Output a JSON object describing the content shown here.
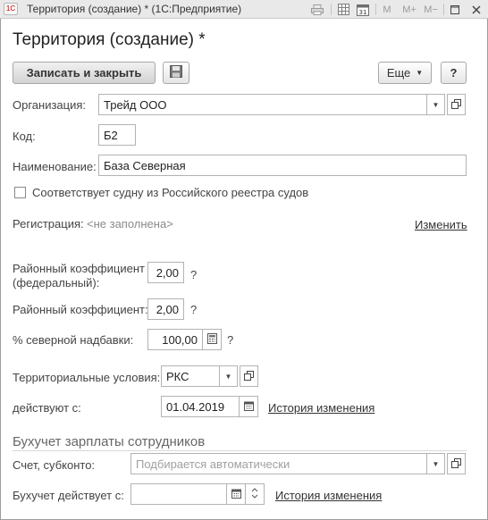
{
  "window": {
    "app_icon_text": "1С",
    "title": "Территория (создание) * (1С:Предприятие)",
    "toolbar_icons": [
      "print-icon",
      "table-icon",
      "calendar-icon",
      "memory-m-icon",
      "memory-mplus-icon",
      "memory-mminus-icon",
      "minimize-icon",
      "maximize-icon",
      "close-icon"
    ],
    "m_label": "M",
    "mplus_label": "M+",
    "mminus_label": "M−"
  },
  "form": {
    "heading": "Территория (создание) *",
    "toolbar": {
      "save_close_label": "Записать и закрыть",
      "more_label": "Еще",
      "help_label": "?"
    },
    "organization": {
      "label": "Организация:",
      "value": "Трейд ООО"
    },
    "code": {
      "label": "Код:",
      "value": "Б2"
    },
    "name": {
      "label": "Наименование:",
      "value": "База Северная"
    },
    "ship_registry": {
      "label": "Соответствует судну из Российского реестра судов",
      "checked": false
    },
    "registration": {
      "label": "Регистрация:",
      "value": "<не заполнена>",
      "action_label": "Изменить"
    },
    "regional_coef_fed": {
      "label_line1": "Районный коэффициент",
      "label_line2": "(федеральный):",
      "value": "2,00",
      "help": "?"
    },
    "regional_coef": {
      "label": "Районный коэффициент:",
      "value": "2,00",
      "help": "?"
    },
    "northern_bonus": {
      "label": "% северной надбавки:",
      "value": "100,00",
      "help": "?"
    },
    "territorial_conditions": {
      "label": "Территориальные условия:",
      "value": "РКС"
    },
    "valid_from": {
      "label": "действуют с:",
      "value": "01.04.2019",
      "history_label": "История изменения"
    },
    "payroll_section": {
      "title": "Бухучет зарплаты сотрудников",
      "account": {
        "label": "Счет, субконто:",
        "placeholder": "Подбирается автоматически"
      },
      "accounting_from": {
        "label": "Бухучет действует с:",
        "value": "",
        "history_label": "История изменения"
      }
    }
  }
}
